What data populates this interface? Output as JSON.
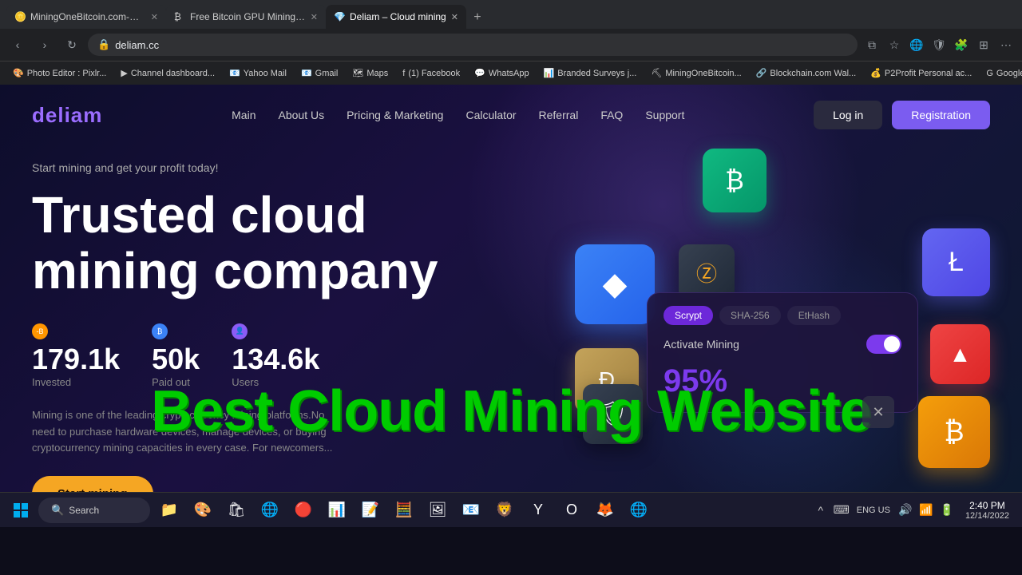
{
  "browser": {
    "tabs": [
      {
        "id": "tab1",
        "label": "MiningOneBitcoin.com-Mining...",
        "favicon": "🪙",
        "active": false
      },
      {
        "id": "tab2",
        "label": "Free Bitcoin GPU Mining, Cloud...",
        "favicon": "₿",
        "active": false
      },
      {
        "id": "tab3",
        "label": "Deliam – Cloud mining",
        "favicon": "💎",
        "active": true
      }
    ],
    "url": "deliam.cc"
  },
  "bookmarks": [
    {
      "label": "Photo Editor : Pixlr...",
      "favicon": "🎨"
    },
    {
      "label": "Channel dashboard...",
      "favicon": "▶"
    },
    {
      "label": "Yahoo Mail",
      "favicon": "📧"
    },
    {
      "label": "Gmail",
      "favicon": "📧"
    },
    {
      "label": "Maps",
      "favicon": "🗺"
    },
    {
      "label": "(1) Facebook",
      "favicon": "f"
    },
    {
      "label": "WhatsApp",
      "favicon": "💬"
    },
    {
      "label": "Branded Surveys j...",
      "favicon": "📊"
    },
    {
      "label": "MiningOneBitcoin...",
      "favicon": "⛏"
    },
    {
      "label": "Blockchain.com Wal...",
      "favicon": "🔗"
    },
    {
      "label": "P2Profit Personal ac...",
      "favicon": "💰"
    },
    {
      "label": "Google AdSense",
      "favicon": "G"
    }
  ],
  "nav": {
    "logo_prefix": "deliam",
    "links": [
      "Main",
      "About Us",
      "Pricing & Marketing",
      "Calculator",
      "Referral",
      "FAQ",
      "Support"
    ],
    "login_label": "Log in",
    "register_label": "Registration"
  },
  "hero": {
    "subtitle": "Start mining and get your profit today!",
    "title_line1": "Trusted cloud",
    "title_line2": "mining company",
    "description": "Mining is one of the leading cryptocurrency mining platforms.No need to purchase hardware devices, manage devices, or buying cryptocurrency mining capacities in every case. For newcomers...",
    "cta_label": "Start mining"
  },
  "stats": [
    {
      "icon": "B",
      "icon_color": "orange",
      "value": "179.1k",
      "label": "Invested"
    },
    {
      "icon": "₿",
      "icon_color": "blue",
      "value": "50k",
      "label": "Paid out"
    },
    {
      "icon": "👤",
      "icon_color": "purple",
      "value": "134.6k",
      "label": "Users"
    }
  ],
  "mining_panel": {
    "tabs": [
      "Scrypt",
      "SHA-256",
      "EtHash"
    ],
    "active_tab": "Scrypt",
    "activate_label": "Activate Mining",
    "percent": "95%"
  },
  "crypto_icons": {
    "eth": "◆",
    "btc_green": "₿",
    "zec": "ⓩ",
    "ltc": "Ł",
    "trx": "▲",
    "btc_orange": "₿",
    "doge": "Ð",
    "shield": "🛡"
  },
  "overlay": {
    "text": "Best Cloud Mining Website"
  },
  "taskbar": {
    "search_label": "Search",
    "clock_time": "2:40 PM",
    "clock_date": "12/14/2022",
    "language": "ENG US"
  }
}
